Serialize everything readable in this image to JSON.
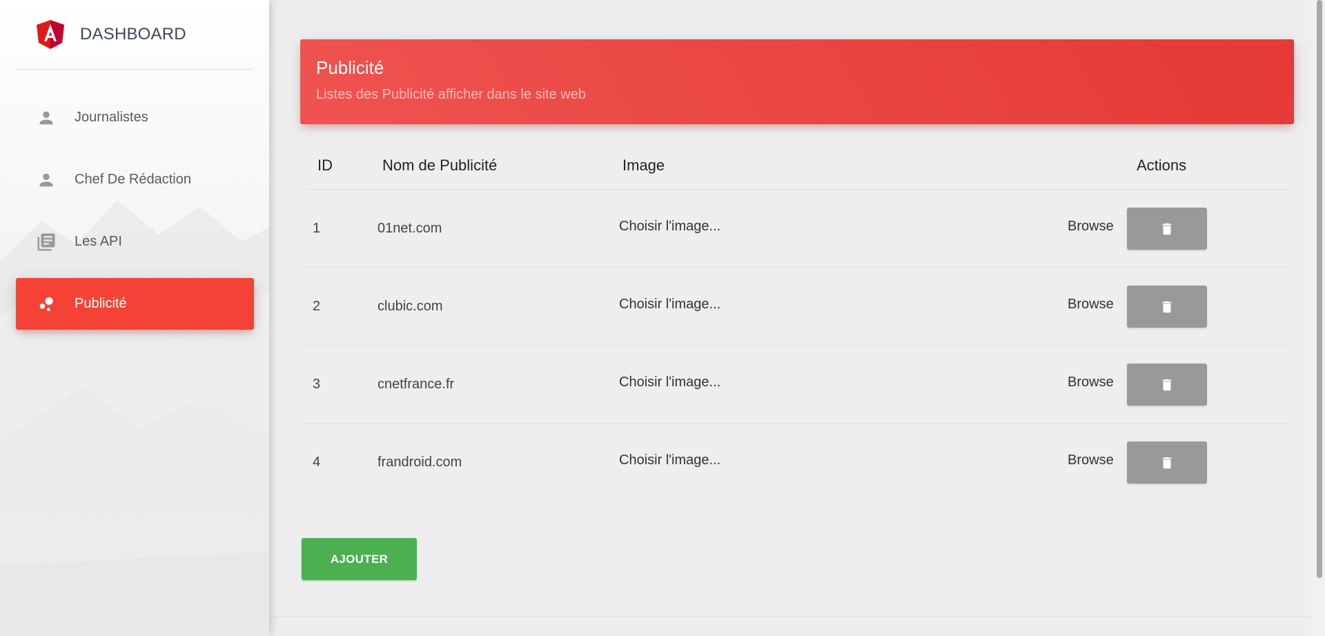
{
  "brand": {
    "title": "DASHBOARD",
    "logo_icon": "angular-logo-icon",
    "logo_color": "#dd1b16"
  },
  "sidebar": {
    "items": [
      {
        "label": "Journalistes",
        "icon": "person-icon",
        "active": false
      },
      {
        "label": "Chef De Rédaction",
        "icon": "person-icon",
        "active": false
      },
      {
        "label": "Les API",
        "icon": "library-books-icon",
        "active": false
      },
      {
        "label": "Publicité",
        "icon": "bubble-chart-icon",
        "active": true
      }
    ],
    "active_color": "#f44336"
  },
  "card": {
    "title": "Publicité",
    "subtitle": "Listes des Publicité afficher dans le site web",
    "header_color": "#e53935"
  },
  "table": {
    "headers": {
      "id": "ID",
      "name": "Nom de Publicité",
      "image": "Image",
      "actions": "Actions"
    },
    "rows": [
      {
        "id": "1",
        "name": "01net.com",
        "image_placeholder": "Choisir l'image...",
        "browse": "Browse"
      },
      {
        "id": "2",
        "name": "clubic.com",
        "image_placeholder": "Choisir l'image...",
        "browse": "Browse"
      },
      {
        "id": "3",
        "name": "cnetfrance.fr",
        "image_placeholder": "Choisir l'image...",
        "browse": "Browse"
      },
      {
        "id": "4",
        "name": "frandroid.com",
        "image_placeholder": "Choisir l'image...",
        "browse": "Browse"
      }
    ],
    "delete_icon": "trash-icon",
    "delete_button_color": "#999999"
  },
  "actions": {
    "add_label": "AJOUTER",
    "add_color": "#4caf50"
  }
}
